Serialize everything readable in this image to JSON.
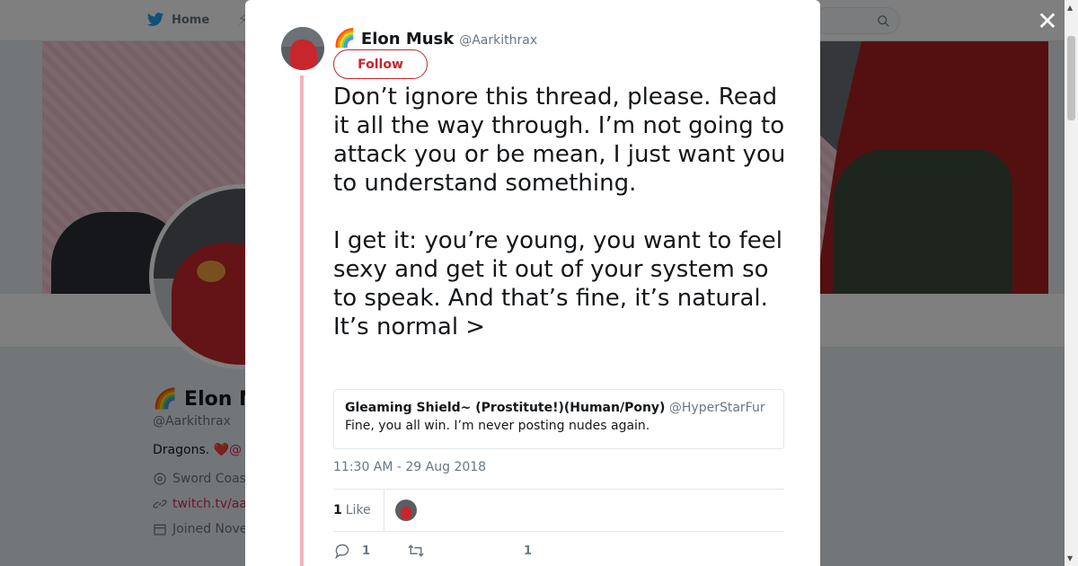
{
  "topbar": {
    "home_label": "Home"
  },
  "profile": {
    "name": "🌈 Elon M",
    "handle": "@Aarkithrax",
    "bio_text": "Dragons. ",
    "bio_heart": "❤️",
    "bio_mention": "@",
    "location": "Sword Coas",
    "link": "twitch.tv/aa",
    "joined": "Joined Nove"
  },
  "modal": {
    "close_glyph": "✕",
    "author": {
      "emoji": "🌈",
      "name": "Elon Musk",
      "handle": "@Aarkithrax"
    },
    "follow_label": "Follow",
    "caret": "⌄",
    "tweet_text": "Don’t ignore this thread, please. Read it all the way through. I’m not going to attack you or be mean, I just want you to understand something.\n\nI get it: you’re young, you want to feel sexy and get it out of your system so to speak. And that’s fine, it’s natural. It’s normal >",
    "quote": {
      "name": "Gleaming Shield~ (Prostitute!)(Human/Pony)",
      "handle": "@HyperStarFur",
      "text": "Fine, you all win. I’m never posting nudes again."
    },
    "timestamp": "11:30 AM - 29 Aug 2018",
    "likes_count": "1",
    "likes_label": "Like",
    "actions": {
      "reply_count": "1",
      "retweet_count": "",
      "like_count": "1"
    }
  },
  "colors": {
    "accent": "#c8262c",
    "thread_line": "#f2b3bf",
    "link": "#e0245e"
  },
  "icons": [
    "twitter-bird-icon",
    "search-icon",
    "close-icon",
    "location-icon",
    "link-icon",
    "calendar-icon",
    "reply-icon",
    "retweet-icon",
    "heart-icon"
  ]
}
